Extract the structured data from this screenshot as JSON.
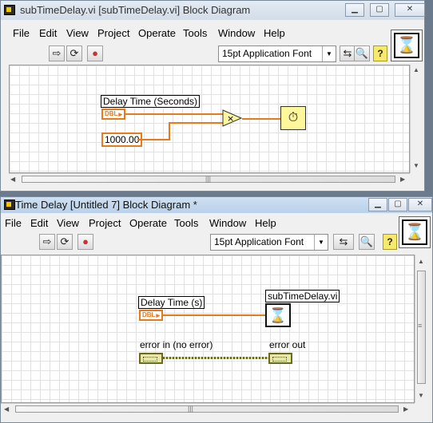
{
  "window1": {
    "title": "subTimeDelay.vi [subTimeDelay.vi] Block Diagram",
    "menu": [
      "File",
      "Edit",
      "View",
      "Project",
      "Operate",
      "Tools",
      "Window",
      "Help"
    ],
    "font_select": "15pt Application Font",
    "diagram": {
      "control_label": "Delay Time (Seconds)",
      "control_type": "DBL",
      "constant_value": "1000.00",
      "multiply_symbol": "×"
    }
  },
  "window2": {
    "title": "Time Delay [Untitled 7] Block Diagram *",
    "menu": [
      "File",
      "Edit",
      "View",
      "Project",
      "Operate",
      "Tools",
      "Window",
      "Help"
    ],
    "font_select": "15pt Application Font",
    "diagram": {
      "control_label": "Delay Time (s)",
      "control_type": "DBL",
      "subvi_label": "subTimeDelay.vi",
      "error_in_label": "error in (no error)",
      "error_out_label": "error out"
    }
  },
  "colors": {
    "double_wire": "#e87a1c",
    "error_cluster": "#6b6b1f",
    "wait_node": "#fff79c"
  },
  "icons": [
    "run-arrow-icon",
    "run-continuous-icon",
    "abort-icon",
    "align-icon",
    "search-icon",
    "help-icon",
    "hourglass-icon",
    "multiply-icon",
    "wait-ms-icon"
  ]
}
